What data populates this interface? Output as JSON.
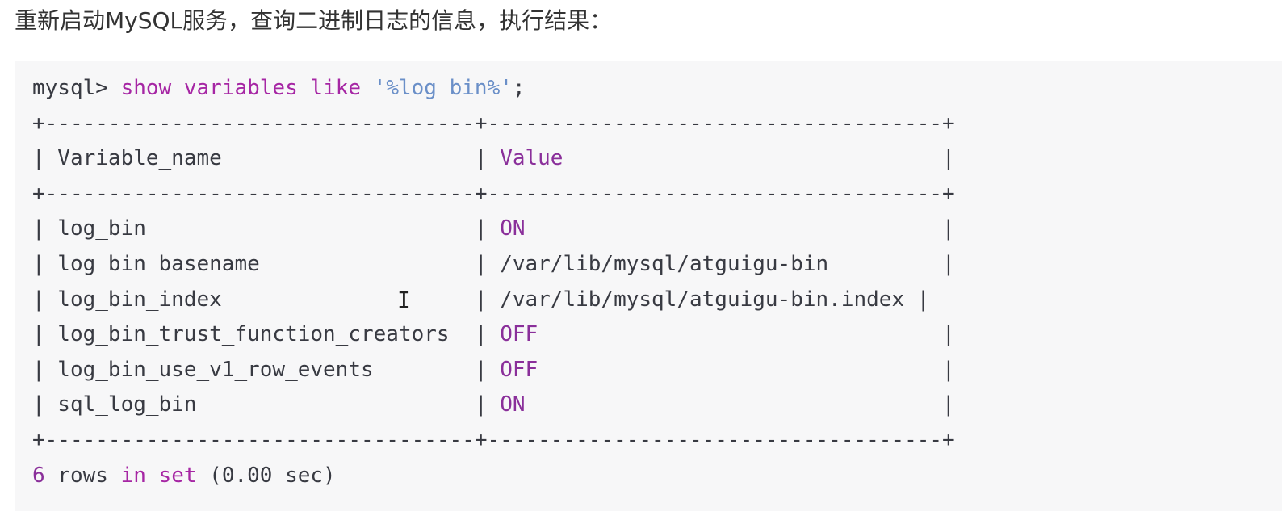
{
  "intro_text": "重新启动MySQL服务，查询二进制日志的信息，执行结果：",
  "query": {
    "prompt": "mysql> ",
    "keyword_show": "show",
    "keyword_variables": "variables",
    "keyword_like": "like",
    "pattern": "'%log_bin%'",
    "terminator": ";"
  },
  "table": {
    "border": "+----------------------------------+------------------------------------+",
    "header": {
      "left": "| Variable_name                    | ",
      "value": "Value",
      "right": "                              |"
    },
    "rows": [
      {
        "name": "| log_bin                          | ",
        "value": "ON",
        "right": "                                 |"
      },
      {
        "name": "| log_bin_basename                 | ",
        "value": "/var/lib/mysql/atguigu-bin",
        "right": "         |"
      },
      {
        "name": "| log_bin_index                    | ",
        "value": "/var/lib/mysql/atguigu-bin.index",
        "right": " |"
      },
      {
        "name": "| log_bin_trust_function_creators  | ",
        "value": "OFF",
        "right": "                                |"
      },
      {
        "name": "| log_bin_use_v1_row_events        | ",
        "value": "OFF",
        "right": "                                |"
      },
      {
        "name": "| sql_log_bin                      | ",
        "value": "ON",
        "right": "                                 |"
      }
    ]
  },
  "footer": {
    "count": "6",
    "rows_word": " rows ",
    "in_word": "in",
    "space": " ",
    "set_word": "set",
    "timing": " (0.00 sec)"
  },
  "cursor_glyph": "I",
  "colors": {
    "keyword": "#a626a4",
    "string": "#6a8fc8",
    "value": "#8a2f9a",
    "text": "#383a42",
    "block_background": "#f7f7f8"
  }
}
